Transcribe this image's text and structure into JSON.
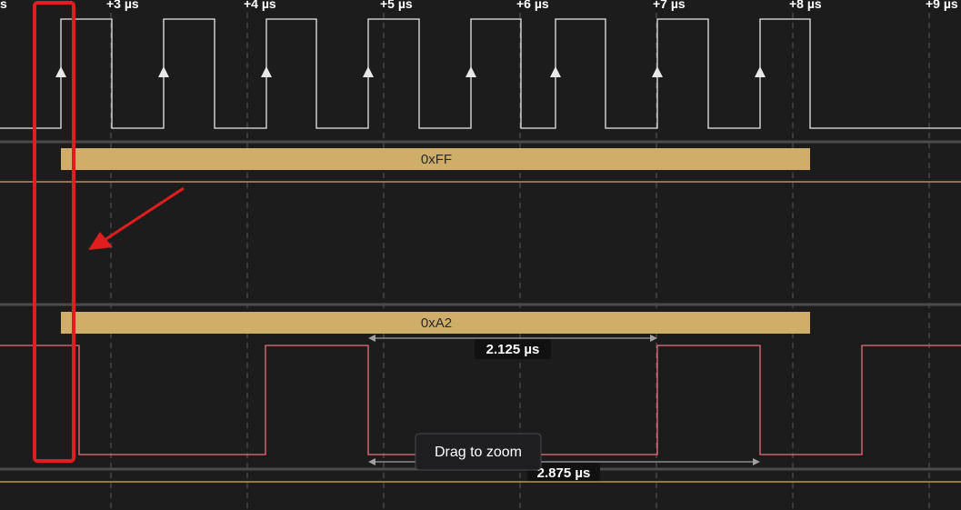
{
  "timeline": {
    "ticks": [
      {
        "label": "s",
        "kind": "edge"
      },
      {
        "label": "+3 µs"
      },
      {
        "label": "+4 µs"
      },
      {
        "label": "+5 µs"
      },
      {
        "label": "+6 µs"
      },
      {
        "label": "+7 µs"
      },
      {
        "label": "+8 µs"
      },
      {
        "label": "+9 µs"
      }
    ]
  },
  "channels": [
    {
      "id": "clock",
      "color": "#e8e8e8",
      "edge_markers": "rising"
    },
    {
      "id": "data-mosi",
      "color": "#d4b06a"
    },
    {
      "id": "data-miso",
      "color": "#f06e78"
    }
  ],
  "decoded": [
    {
      "value": "0xFF"
    },
    {
      "value": "0xA2"
    }
  ],
  "measurements": [
    {
      "label": "2.125 µs"
    },
    {
      "label": "2.875 µs"
    }
  ],
  "tooltip": {
    "text": "Drag to zoom"
  },
  "colors": {
    "background": "#1c1c1c",
    "grid": "#5a5a5a",
    "separator": "#4b4b4b",
    "decode_fill": "#cfae6a",
    "annotation": "#e01e1e",
    "measure": "#a0a0a0"
  }
}
